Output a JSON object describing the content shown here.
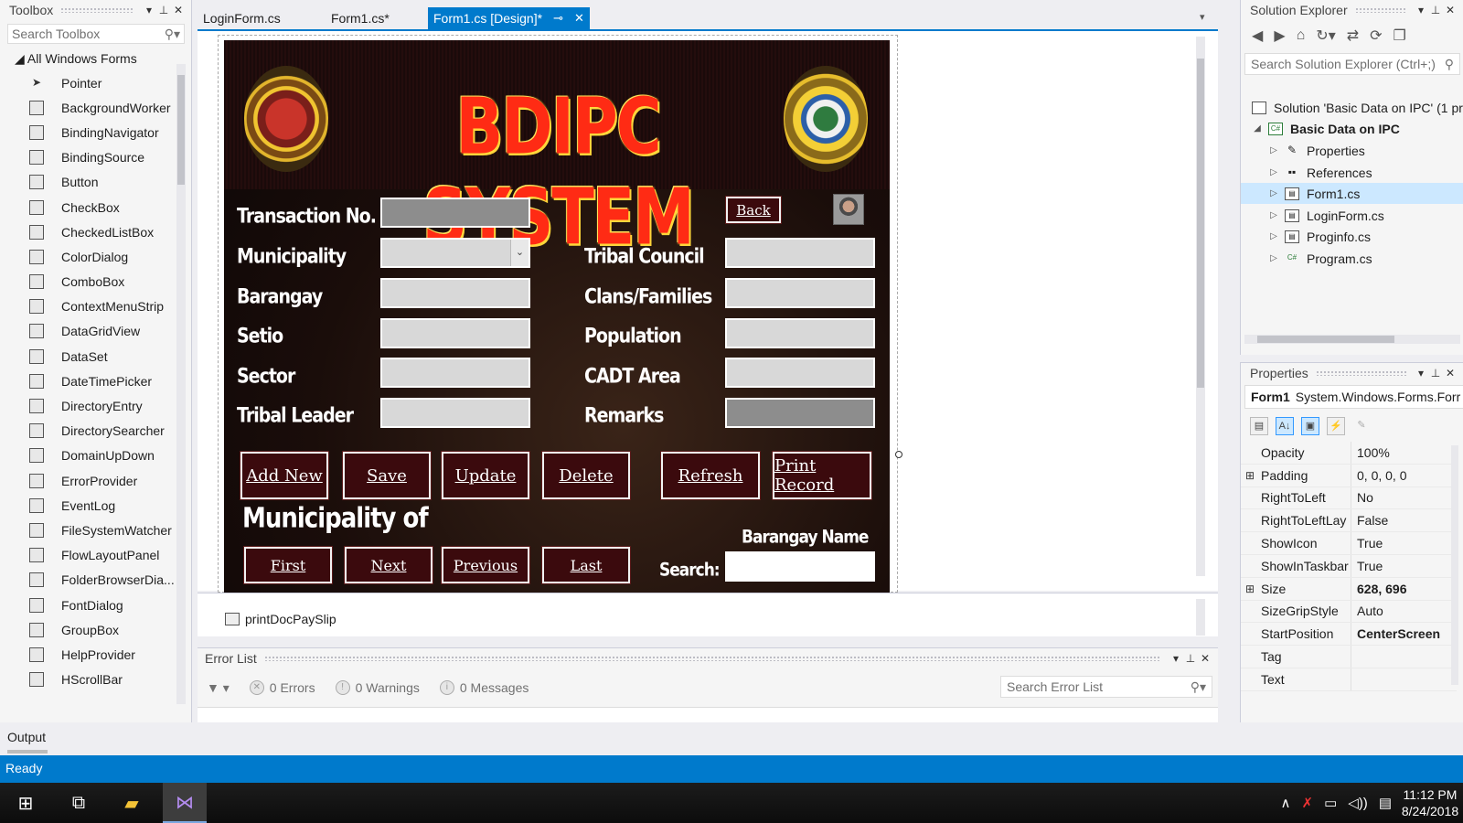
{
  "toolbox": {
    "title": "Toolbox",
    "search_placeholder": "Search Toolbox",
    "group": "All Windows Forms",
    "items": [
      {
        "label": "Pointer",
        "icon": "pointer-icon"
      },
      {
        "label": "BackgroundWorker",
        "icon": "background-worker-icon"
      },
      {
        "label": "BindingNavigator",
        "icon": "binding-navigator-icon"
      },
      {
        "label": "BindingSource",
        "icon": "binding-source-icon"
      },
      {
        "label": "Button",
        "icon": "button-icon"
      },
      {
        "label": "CheckBox",
        "icon": "checkbox-icon"
      },
      {
        "label": "CheckedListBox",
        "icon": "checked-list-box-icon"
      },
      {
        "label": "ColorDialog",
        "icon": "color-dialog-icon"
      },
      {
        "label": "ComboBox",
        "icon": "combo-box-icon"
      },
      {
        "label": "ContextMenuStrip",
        "icon": "context-menu-strip-icon"
      },
      {
        "label": "DataGridView",
        "icon": "data-grid-view-icon"
      },
      {
        "label": "DataSet",
        "icon": "dataset-icon"
      },
      {
        "label": "DateTimePicker",
        "icon": "date-time-picker-icon"
      },
      {
        "label": "DirectoryEntry",
        "icon": "directory-entry-icon"
      },
      {
        "label": "DirectorySearcher",
        "icon": "directory-searcher-icon"
      },
      {
        "label": "DomainUpDown",
        "icon": "domain-up-down-icon"
      },
      {
        "label": "ErrorProvider",
        "icon": "error-provider-icon"
      },
      {
        "label": "EventLog",
        "icon": "event-log-icon"
      },
      {
        "label": "FileSystemWatcher",
        "icon": "file-system-watcher-icon"
      },
      {
        "label": "FlowLayoutPanel",
        "icon": "flow-layout-panel-icon"
      },
      {
        "label": "FolderBrowserDia...",
        "icon": "folder-browser-dialog-icon"
      },
      {
        "label": "FontDialog",
        "icon": "font-dialog-icon"
      },
      {
        "label": "GroupBox",
        "icon": "group-box-icon"
      },
      {
        "label": "HelpProvider",
        "icon": "help-provider-icon"
      },
      {
        "label": "HScrollBar",
        "icon": "hscrollbar-icon"
      }
    ]
  },
  "tabs": [
    {
      "label": "LoginForm.cs",
      "active": false
    },
    {
      "label": "Form1.cs*",
      "active": false
    },
    {
      "label": "Form1.cs [Design]*",
      "active": true
    }
  ],
  "form": {
    "title": "BDIPC SYSTEM",
    "labels": {
      "transaction_no": "Transaction No.",
      "municipality": "Municipality",
      "barangay": "Barangay",
      "setio": "Setio",
      "sector": "Sector",
      "tribal_leader": "Tribal Leader",
      "tribal_council": "Tribal Council",
      "clans": "Clans/Families",
      "population": "Population",
      "cadt_area": "CADT Area",
      "remarks": "Remarks",
      "municipality_of": "Municipality of",
      "barangay_name": "Barangay Name",
      "search": "Search:"
    },
    "buttons": {
      "back": "Back",
      "add_new": "Add New",
      "save": "Save",
      "update": "Update",
      "delete": "Delete",
      "refresh": "Refresh",
      "print_record": "Print Record",
      "first": "First",
      "next": "Next",
      "previous": "Previous",
      "last": "Last"
    }
  },
  "component_tray": {
    "item": "printDocPaySlip"
  },
  "error_list": {
    "title": "Error List",
    "errors": "0 Errors",
    "warnings": "0 Warnings",
    "messages": "0 Messages",
    "search_placeholder": "Search Error List"
  },
  "solution_explorer": {
    "title": "Solution Explorer",
    "search_placeholder": "Search Solution Explorer (Ctrl+;)",
    "solution": "Solution 'Basic Data on IPC' (1 pr",
    "project": "Basic Data on IPC",
    "items": [
      "Properties",
      "References",
      "Form1.cs",
      "LoginForm.cs",
      "Proginfo.cs",
      "Program.cs"
    ],
    "selected": "Form1.cs"
  },
  "properties": {
    "title": "Properties",
    "object_name": "Form1",
    "object_type": "System.Windows.Forms.Forr",
    "rows": [
      {
        "name": "Opacity",
        "value": "100%",
        "expand": ""
      },
      {
        "name": "Padding",
        "value": "0, 0, 0, 0",
        "expand": "⊞"
      },
      {
        "name": "RightToLeft",
        "value": "No",
        "expand": ""
      },
      {
        "name": "RightToLeftLay",
        "value": "False",
        "expand": ""
      },
      {
        "name": "ShowIcon",
        "value": "True",
        "expand": ""
      },
      {
        "name": "ShowInTaskbar",
        "value": "True",
        "expand": ""
      },
      {
        "name": "Size",
        "value": "628, 696",
        "expand": "⊞",
        "bold": true
      },
      {
        "name": "SizeGripStyle",
        "value": "Auto",
        "expand": ""
      },
      {
        "name": "StartPosition",
        "value": "CenterScreen",
        "expand": "",
        "bold": true
      },
      {
        "name": "Tag",
        "value": "",
        "expand": ""
      },
      {
        "name": "Text",
        "value": "",
        "expand": ""
      }
    ]
  },
  "output": {
    "label": "Output"
  },
  "status": {
    "text": "Ready"
  },
  "taskbar": {
    "time": "11:12 PM",
    "date": "8/24/2018"
  }
}
